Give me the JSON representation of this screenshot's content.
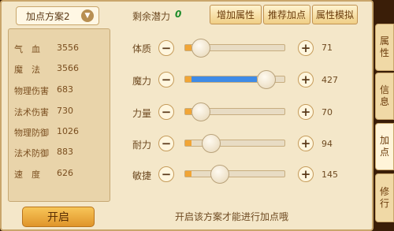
{
  "plan_select": {
    "label": "加点方案2",
    "chevron": "chevron-down-icon"
  },
  "stats": [
    {
      "label": "气　血",
      "value": "3556"
    },
    {
      "label": "魔　法",
      "value": "3566"
    },
    {
      "label": "物理伤害",
      "value": "683"
    },
    {
      "label": "法术伤害",
      "value": "730"
    },
    {
      "label": "物理防御",
      "value": "1026"
    },
    {
      "label": "法术防御",
      "value": "883"
    },
    {
      "label": "速　度",
      "value": "626"
    }
  ],
  "open_button": "开启",
  "potential": {
    "label": "剩余潜力",
    "value": "0"
  },
  "top_buttons": [
    "增加属性",
    "推荐加点",
    "属性模拟"
  ],
  "attributes": [
    {
      "label": "体质",
      "value": "71",
      "level": 0.07
    },
    {
      "label": "魔力",
      "value": "427",
      "level": 0.84
    },
    {
      "label": "力量",
      "value": "70",
      "level": 0.07
    },
    {
      "label": "耐力",
      "value": "94",
      "level": 0.19
    },
    {
      "label": "敏捷",
      "value": "145",
      "level": 0.3
    }
  ],
  "controls": {
    "minus": "−",
    "plus": "+"
  },
  "hint": "开启该方案才能进行加点哦",
  "side_tabs": [
    {
      "label": "属\n性",
      "active": false
    },
    {
      "label": "信\n息",
      "active": false
    },
    {
      "label": "加\n点",
      "active": true
    },
    {
      "label": "修\n行",
      "active": false
    }
  ],
  "colors": {
    "accent_orange": "#f1a536",
    "accent_blue": "#3f8be6",
    "potential_green": "#1e8c2a"
  }
}
